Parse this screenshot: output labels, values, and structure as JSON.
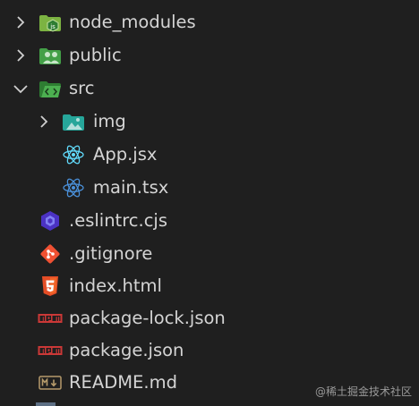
{
  "explorer": {
    "items": [
      {
        "label": "node_modules",
        "icon": "node-modules-folder-icon",
        "chevron": "right"
      },
      {
        "label": "public",
        "icon": "public-folder-icon",
        "chevron": "right"
      },
      {
        "label": "src",
        "icon": "src-folder-icon",
        "chevron": "down"
      },
      {
        "label": "img",
        "icon": "image-folder-icon",
        "chevron": "right"
      },
      {
        "label": "App.jsx",
        "icon": "react-jsx-icon"
      },
      {
        "label": "main.tsx",
        "icon": "react-tsx-icon"
      },
      {
        "label": ".eslintrc.cjs",
        "icon": "eslint-icon"
      },
      {
        "label": ".gitignore",
        "icon": "git-icon"
      },
      {
        "label": "index.html",
        "icon": "html5-icon"
      },
      {
        "label": "package-lock.json",
        "icon": "npm-icon"
      },
      {
        "label": "package.json",
        "icon": "npm-icon"
      },
      {
        "label": "README.md",
        "icon": "markdown-icon"
      }
    ]
  },
  "colors": {
    "background": "#1f1f1f",
    "text": "#d4d4d4",
    "folder_green": "#4caf50",
    "react_blue": "#61dafb",
    "eslint_purple": "#4b32c3",
    "git_orange": "#f05133",
    "html_orange": "#e44d26",
    "npm_red": "#cb3837",
    "markdown_tan": "#b59a6b"
  },
  "watermark": "@稀土掘金技术社区"
}
